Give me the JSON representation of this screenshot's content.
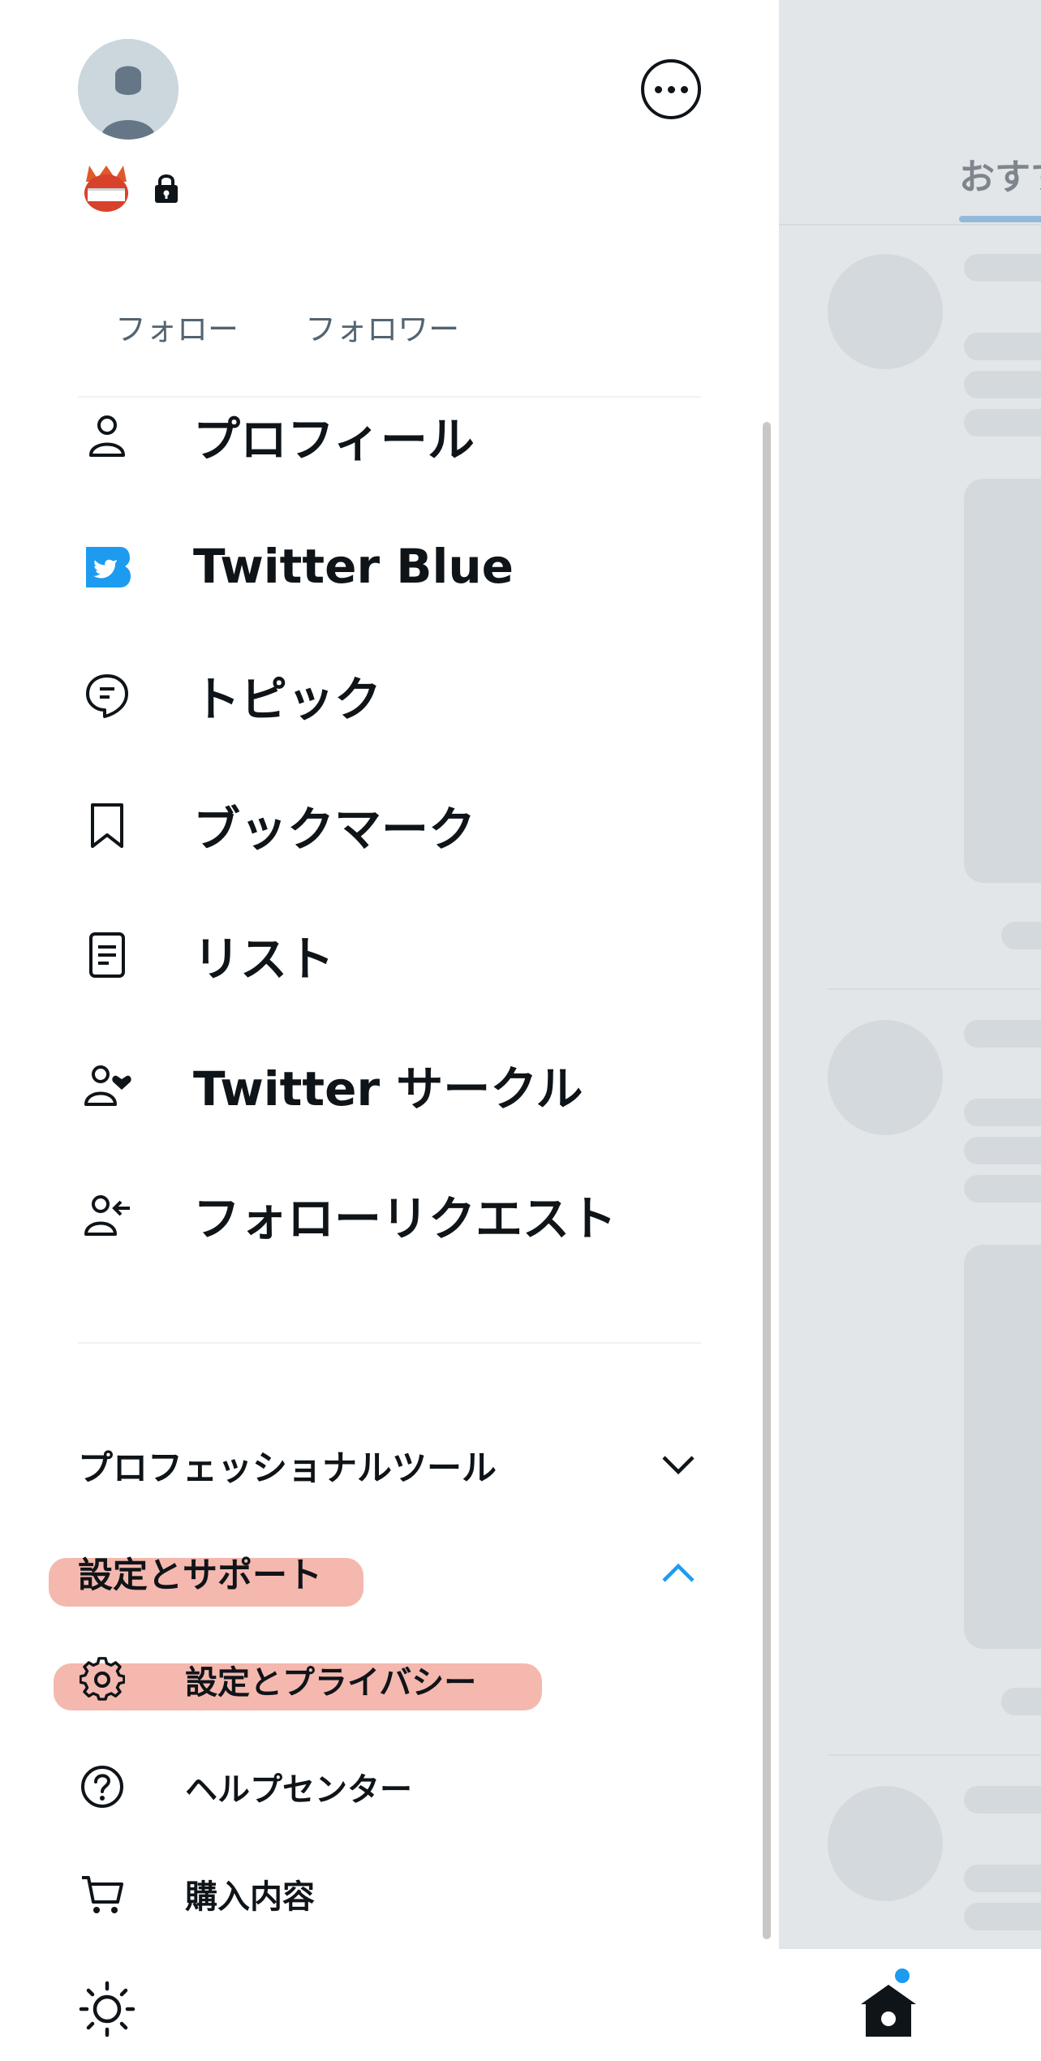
{
  "profile": {
    "following_label": "フォロー",
    "followers_label": "フォロワー"
  },
  "menu": {
    "items": [
      {
        "label": "プロフィール",
        "icon": "person-icon"
      },
      {
        "label": "Twitter Blue",
        "icon": "twitter-blue-icon"
      },
      {
        "label": "トピック",
        "icon": "topic-icon"
      },
      {
        "label": "ブックマーク",
        "icon": "bookmark-icon"
      },
      {
        "label": "リスト",
        "icon": "list-icon"
      },
      {
        "label": "Twitter サークル",
        "icon": "circle-people-icon"
      },
      {
        "label": "フォローリクエスト",
        "icon": "follow-request-icon"
      }
    ]
  },
  "sections": {
    "professional": {
      "label": "プロフェッショナルツール",
      "expanded": false
    },
    "settings": {
      "label": "設定とサポート",
      "expanded": true
    }
  },
  "sub_items": [
    {
      "label": "設定とプライバシー",
      "icon": "gear-icon"
    },
    {
      "label": "ヘルプセンター",
      "icon": "help-icon"
    },
    {
      "label": "購入内容",
      "icon": "cart-icon"
    }
  ],
  "background": {
    "tab_label": "おすすめ"
  },
  "colors": {
    "accent": "#1d9bf0",
    "text": "#0f1419",
    "secondary_text": "#536471",
    "highlight": "#f19a8b"
  }
}
